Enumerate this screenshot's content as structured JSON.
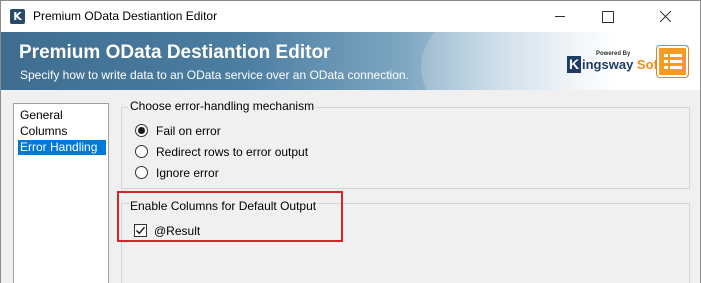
{
  "window": {
    "title": "Premium OData Destiantion Editor",
    "app_icon": "K"
  },
  "banner": {
    "title": "Premium OData Destiantion Editor",
    "subtitle": "Specify how to write data to an OData service over an OData connection.",
    "logo_powered_by": "Powered By",
    "logo_k": "K",
    "logo_word_1": "ingsway",
    "logo_word_2": "Soft"
  },
  "nav": {
    "items": [
      {
        "label": "General",
        "selected": false
      },
      {
        "label": "Columns",
        "selected": false
      },
      {
        "label": "Error Handling",
        "selected": true
      }
    ]
  },
  "error_group": {
    "legend": "Choose error-handling mechanism",
    "options": [
      {
        "label": "Fail on error",
        "checked": true
      },
      {
        "label": "Redirect rows to error output",
        "checked": false
      },
      {
        "label": "Ignore error",
        "checked": false
      }
    ]
  },
  "output_group": {
    "legend": "Enable Columns for Default Output",
    "columns": [
      {
        "label": "@Result",
        "checked": true
      }
    ]
  },
  "colors": {
    "selection": "#0078d7",
    "highlight_border": "#d4262a",
    "banner_blue": "#3e6d8f",
    "brand_orange": "#f39c25"
  }
}
